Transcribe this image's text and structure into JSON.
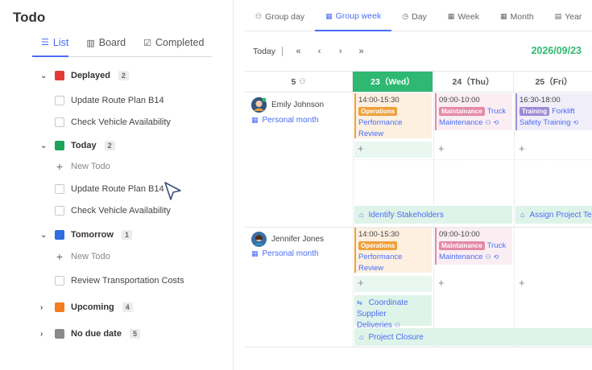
{
  "app": {
    "title": "Todo"
  },
  "left_tabs": [
    {
      "label": "List",
      "icon": "list-icon"
    },
    {
      "label": "Board",
      "icon": "board-icon"
    },
    {
      "label": "Completed",
      "icon": "check-square-icon"
    }
  ],
  "groups": {
    "delayed": {
      "label": "Deplayed",
      "count": "2",
      "color": "#e53935",
      "items": [
        "Update Route Plan B14",
        "Check Vehicle Availability"
      ]
    },
    "today": {
      "label": "Today",
      "count": "2",
      "color": "#1ea35a",
      "new_label": "New Todo",
      "items": [
        "Update Route Plan B14",
        "Check Vehicle Availability"
      ]
    },
    "tomorrow": {
      "label": "Tomorrow",
      "count": "1",
      "color": "#2f6fe0",
      "new_label": "New Todo",
      "items": [
        "Review Transportation Costs"
      ]
    },
    "upcoming": {
      "label": "Upcoming",
      "count": "4",
      "color": "#f57c1f"
    },
    "no_due_date": {
      "label": "No due date",
      "count": "5",
      "color": "#8a8a8a"
    }
  },
  "view_tabs": [
    {
      "label": "Group day",
      "icon": "group-icon"
    },
    {
      "label": "Group week",
      "icon": "calendar-icon"
    },
    {
      "label": "Day",
      "icon": "clock-icon"
    },
    {
      "label": "Week",
      "icon": "calendar-icon"
    },
    {
      "label": "Month",
      "icon": "calendar-icon"
    },
    {
      "label": "Year",
      "icon": "calendar-icon"
    }
  ],
  "active_view": "Group week",
  "toolbar": {
    "today": "Today",
    "first": "«",
    "prev": "‹",
    "next": "›",
    "last": "»",
    "date": "2026/09/23"
  },
  "header": {
    "col0": "5",
    "days": [
      "23（Wed）",
      "24（Thu）",
      "25（Fri）"
    ]
  },
  "people": [
    {
      "name": "Emily Johnson",
      "calendar": "Personal month",
      "events": [
        {
          "time": "14:00-15:30",
          "tag": "Operations",
          "title": "Performance Review"
        },
        {
          "time": "09:00-10:00",
          "tag": "Maintainance",
          "title_a": "Truck",
          "title_b": "Maintenance"
        },
        {
          "time": "16:30-18:00",
          "tag": "Training",
          "title_a": "Forklift",
          "title_b": "Safety Training"
        }
      ],
      "bars": [
        "Identify Stakeholders",
        "Assign Project Team"
      ]
    },
    {
      "name": "Jennifer Jones",
      "calendar": "Personal month",
      "events": [
        {
          "time": "14:00-15:30",
          "tag": "Operations",
          "title": "Performance Review"
        },
        {
          "time": "09:00-10:00",
          "tag": "Maintainance",
          "title_a": "Truck",
          "title_b": "Maintenance"
        }
      ],
      "bars": [
        "Coordinate",
        "Supplier Deliveries",
        "Project Closure"
      ]
    }
  ],
  "colors": {
    "accent": "#4a6cf7",
    "today": "#2eb872"
  }
}
